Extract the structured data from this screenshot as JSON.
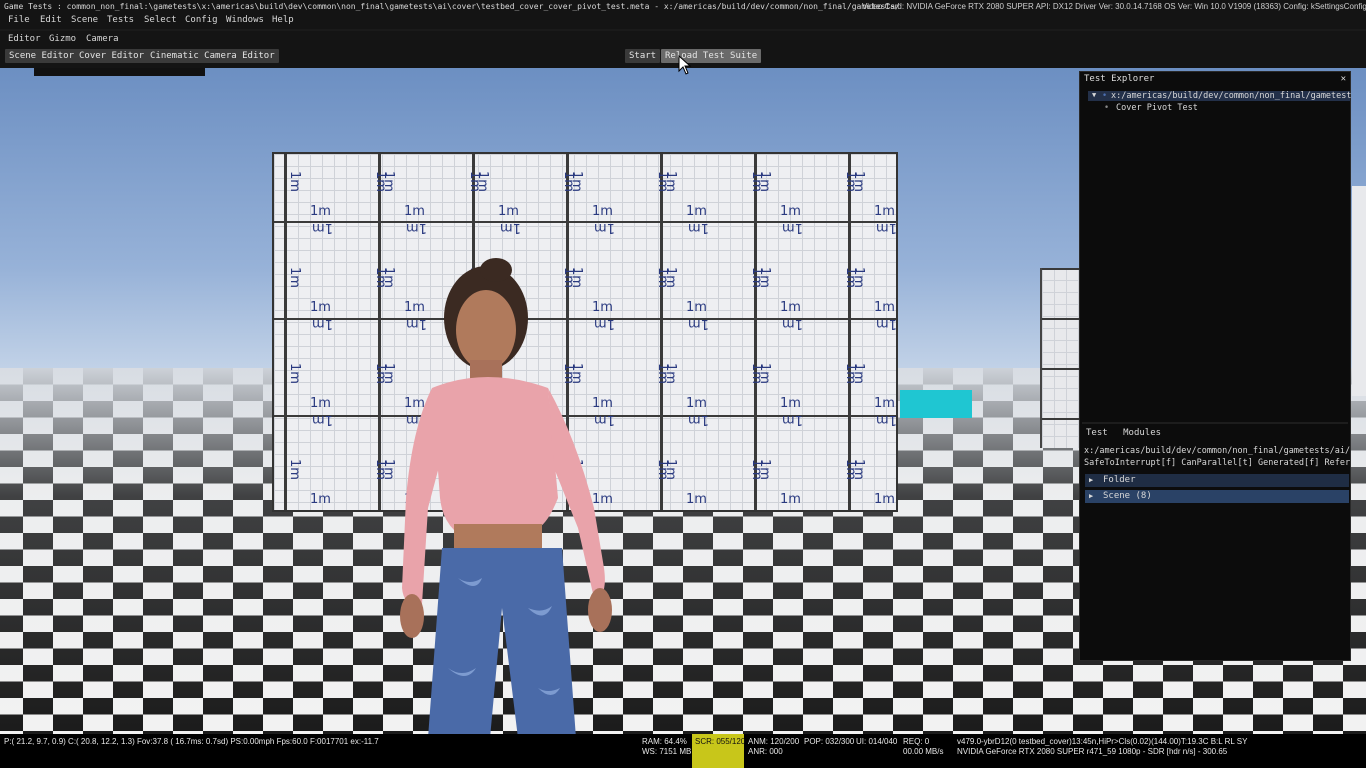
{
  "titlebar": {
    "text": "Game Tests : common_non_final:\\gametests\\x:\\americas\\build\\dev\\common\\non_final\\gametests\\ai\\cover\\testbed_cover_cover_pivot_test.meta - x:/americas/build/dev/common/non_final/gametests/",
    "right": "Video Card: NVIDIA GeForce RTX 2080 SUPER API: DX12 Driver Ver: 30.0.14.7168 OS Ver: Win 10.0 V1909 (18363) Config: kSettingsConfig_Auto"
  },
  "menu": [
    "File",
    "Edit",
    "Scene",
    "Tests",
    "Select",
    "Config",
    "Windows",
    "Help"
  ],
  "submenu": [
    "Editor",
    "Gizmo",
    "Camera"
  ],
  "toolbar": {
    "editors": [
      "Scene Editor",
      "Cover Editor",
      "Cinematic Camera Editor"
    ],
    "start": "Start",
    "reload": "Reload Test Suite"
  },
  "wall_label": "1m",
  "explorer": {
    "title": "Test Explorer",
    "close": "✕",
    "root": "x:/americas/build/dev/common/non_final/gametests",
    "child": "Cover Pivot Test",
    "tabs": [
      "Test",
      "Modules"
    ],
    "path": "x:/americas/build/dev/common/non_final/gametests/ai/c",
    "flags": "SafeToInterrupt[f] CanParallel[t] Generated[f] Refere",
    "nodes": [
      "Folder",
      "Scene (8)"
    ]
  },
  "status": {
    "left": "P:( 21.2,   9.7,   0.9) C:( 20.8,  12.2,   1.3) Fov:37.8 ( 16.7ms:  0.7sd) PS:0.00mph  Fps:60.0 F:0017701 ex:-11.7",
    "ram": "RAM:  64.4%",
    "ws": "WS: 7151 MB",
    "scr": "SCR: 055/120",
    "anm": "ANM: 120/200",
    "anr": "ANR: 000",
    "pop": "POP: 032/300",
    "ui": "UI: 014/040",
    "req": "REQ: 0",
    "mbs": "00.00 MB/s",
    "build1": "v479.0-ybrD12(0 testbed_cover)13:45n,HiPr>Cls(0.02)(144.00)T:19.3C B:L RL SY",
    "build2": "NVIDIA GeForce RTX 2080 SUPER r471_59 1080p - SDR [hdr n/s] - 300.65"
  }
}
